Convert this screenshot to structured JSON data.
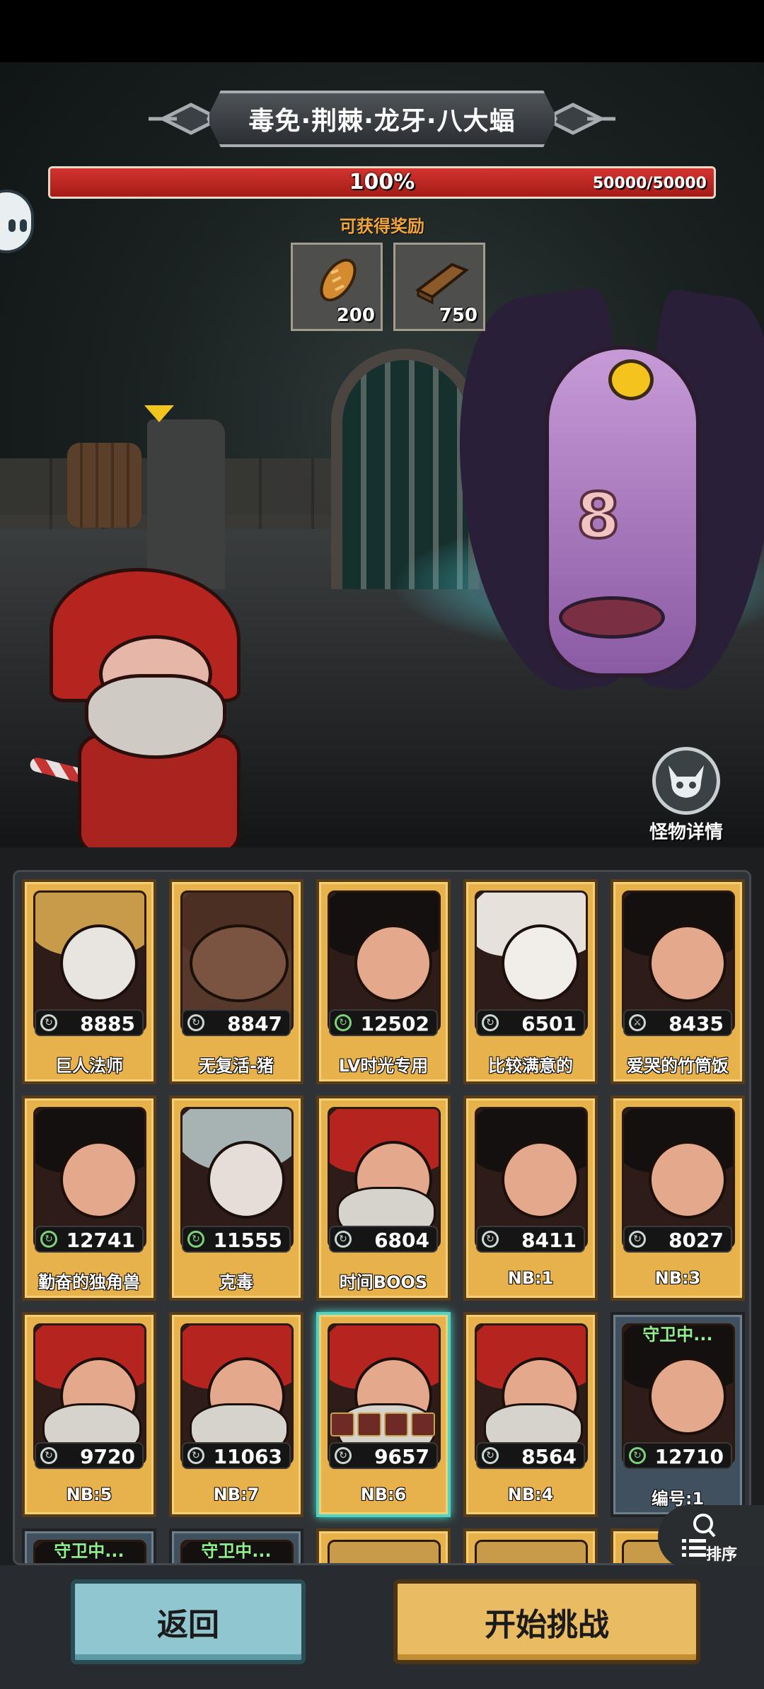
{
  "boss": {
    "name": "毒免·荆棘·龙牙·八大蝠",
    "hp_percent_label": "100%",
    "hp_value": "50000/50000",
    "hp_fraction": 1.0,
    "body_mark": "8"
  },
  "rewards": {
    "label": "可获得奖励",
    "items": [
      {
        "icon": "bread-icon",
        "qty": "200"
      },
      {
        "icon": "wood-log-icon",
        "qty": "750"
      }
    ]
  },
  "monster_detail": {
    "label": "怪物详情"
  },
  "roster": {
    "cards": [
      {
        "name": "巨人法师",
        "power": "8885",
        "portrait": "blond",
        "power_icon": "gray"
      },
      {
        "name": "无复活-猪",
        "power": "8847",
        "portrait": "pig",
        "power_icon": "gray"
      },
      {
        "name": "LV时光专用",
        "power": "12502",
        "portrait": "hooded",
        "power_icon": "green"
      },
      {
        "name": "比较满意的",
        "power": "6501",
        "portrait": "snow",
        "power_icon": "gray"
      },
      {
        "name": "爱哭的竹筒饭",
        "power": "8435",
        "portrait": "hooded",
        "power_icon": "sword"
      },
      {
        "name": "勤奋的独角兽",
        "power": "12741",
        "portrait": "hooded",
        "power_icon": "green"
      },
      {
        "name": "克毒",
        "power": "11555",
        "portrait": "silver",
        "power_icon": "green"
      },
      {
        "name": "时间BOOS",
        "power": "6804",
        "portrait": "santa",
        "power_icon": "gray"
      },
      {
        "name": "NB:1",
        "power": "8411",
        "portrait": "hooded",
        "power_icon": "gray"
      },
      {
        "name": "NB:3",
        "power": "8027",
        "portrait": "hooded",
        "power_icon": "gray"
      },
      {
        "name": "NB:5",
        "power": "9720",
        "portrait": "santa",
        "power_icon": "gray"
      },
      {
        "name": "NB:7",
        "power": "11063",
        "portrait": "santa",
        "power_icon": "gray"
      },
      {
        "name": "NB:6",
        "power": "9657",
        "portrait": "santa",
        "power_icon": "gray",
        "selected": true
      },
      {
        "name": "NB:4",
        "power": "8564",
        "portrait": "santa",
        "power_icon": "gray"
      },
      {
        "name": "编号:1",
        "power": "12710",
        "portrait": "hooded",
        "power_icon": "green",
        "status": "守卫中..."
      }
    ],
    "partial_row_status": [
      "守卫中...",
      "守卫中..."
    ]
  },
  "sort": {
    "label": "排序"
  },
  "buttons": {
    "back": "返回",
    "start": "开始挑战"
  },
  "colors": {
    "hp_red": "#c62a25",
    "card_gold": "#e7b24b",
    "selected_teal": "#4bd7c4",
    "back_btn": "#8fc6cf",
    "start_btn": "#e9bb63"
  }
}
